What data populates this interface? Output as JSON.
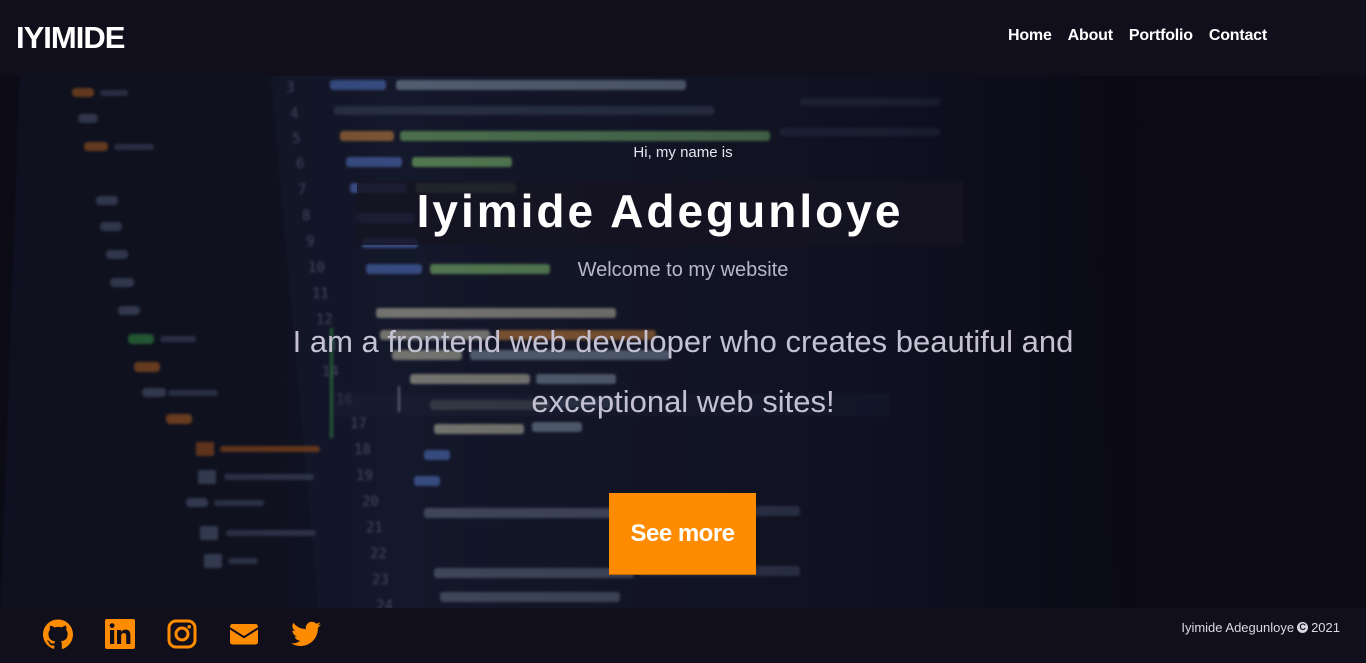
{
  "nav": {
    "brand": "IYIMIDE",
    "links": [
      "Home",
      "About",
      "Portfolio",
      "Contact"
    ]
  },
  "hero": {
    "greeting": "Hi, my name is",
    "name": "Iyimide Adegunloye",
    "welcome": "Welcome to my website",
    "tagline": "I am a frontend web developer who creates beautiful and exceptional web sites!",
    "cta_label": "See more"
  },
  "footer": {
    "social_icons": [
      "github-icon",
      "linkedin-icon",
      "instagram-icon",
      "email-icon",
      "twitter-icon"
    ],
    "copyright_name": "Iyimide Adegunloye",
    "copyright_symbol": "C",
    "copyright_year": "2021"
  },
  "colors": {
    "accent": "#ff8c00",
    "background": "#110f1c",
    "text": "#ffffff"
  }
}
